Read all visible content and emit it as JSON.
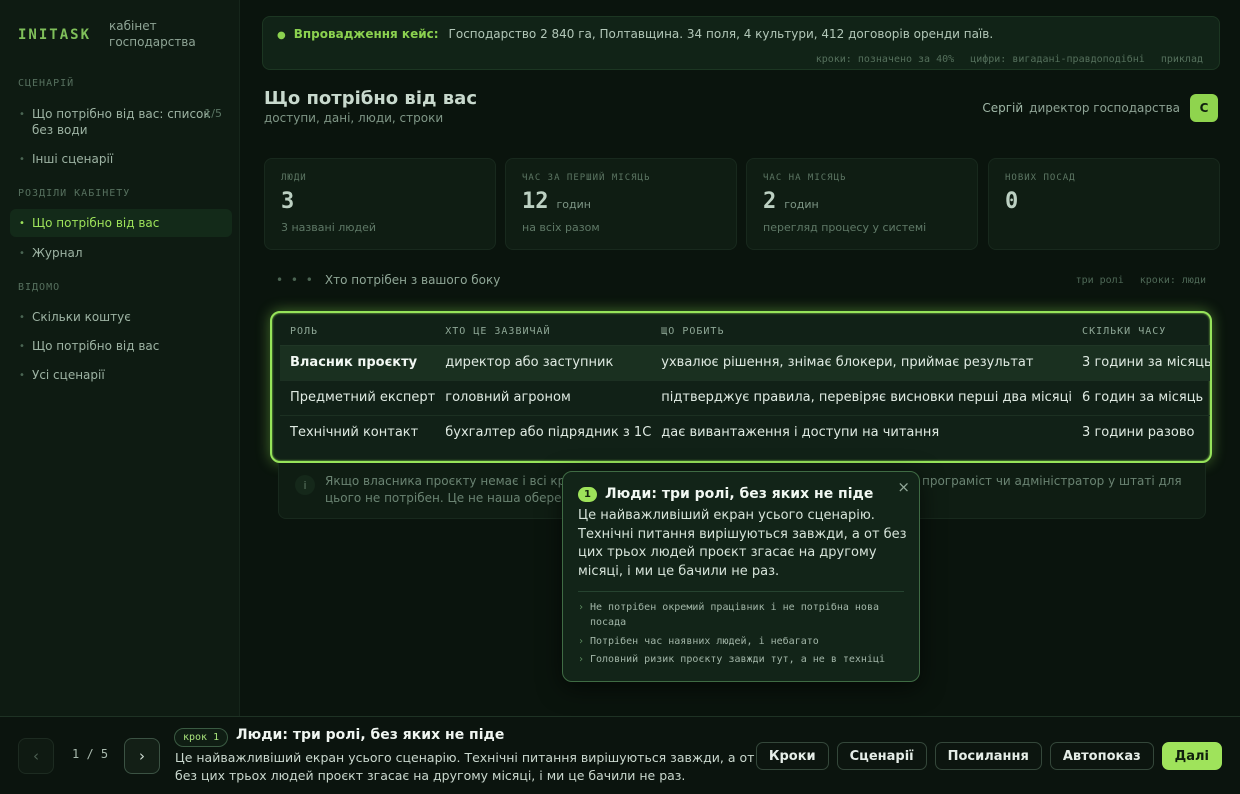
{
  "brand": {
    "logo": "INITASK",
    "subtitle": "кабінет господарства"
  },
  "sidebar": {
    "sections": [
      {
        "title": "СЦЕНАРІЙ",
        "items": [
          {
            "label": "Що потрібно від вас: список без води",
            "count": "1/5"
          },
          {
            "label": "Інші сценарії"
          }
        ]
      },
      {
        "title": "РОЗДІЛИ КАБІНЕТУ",
        "items": [
          {
            "label": "Що потрібно від вас",
            "active": true
          },
          {
            "label": "Журнал"
          }
        ]
      },
      {
        "title": "ВІДОМО",
        "items": [
          {
            "label": "Скільки коштує"
          },
          {
            "label": "Що потрібно від вас"
          },
          {
            "label": "Усі сценарії"
          }
        ]
      }
    ]
  },
  "banner": {
    "label": "Впровадження кейс:",
    "text": "Господарство 2 840 га, Полтавщина. 34 поля, 4 культури, 412 договорів оренди паїв.",
    "meta": [
      "кроки: позначено за 40%",
      "цифри: вигадані-правдоподібні",
      "приклад"
    ]
  },
  "header": {
    "title": "Що потрібно від вас",
    "subtitle": "доступи, дані, люди, строки",
    "user_name": "Сергій",
    "user_role": "директор господарства",
    "avatar": "С"
  },
  "stats": [
    {
      "label": "ЛЮДИ",
      "value": "3",
      "unit": "",
      "foot": "3 названі людей"
    },
    {
      "label": "ЧАС ЗА ПЕРШИЙ МІСЯЦЬ",
      "value": "12",
      "unit": "годин",
      "foot": "на всіх разом"
    },
    {
      "label": "ЧАС НА МІСЯЦЬ",
      "value": "2",
      "unit": "годин",
      "foot": "перегляд процесу у системі"
    },
    {
      "label": "НОВИХ ПОСАД",
      "value": "0",
      "unit": "",
      "foot": ""
    }
  ],
  "section": {
    "dots": "• • •",
    "title": "Хто потрібен з вашого боку",
    "right": [
      "три ролі",
      "кроки: люди"
    ]
  },
  "table": {
    "headers": [
      "РОЛЬ",
      "ХТО ЦЕ ЗАЗВИЧАЙ",
      "ЩО РОБИТЬ",
      "СКІЛЬКИ ЧАСУ"
    ],
    "rows": [
      {
        "role": "Власник проєкту",
        "who": "директор або заступник",
        "what": "ухвалює рішення, знімає блокери, приймає результат",
        "time": "3 години за місяць"
      },
      {
        "role": "Предметний експерт",
        "who": "головний агроном",
        "what": "підтверджує правила, перевіряє висновки перші два місяці",
        "time": "6 годин за місяць"
      },
      {
        "role": "Технічний контакт",
        "who": "бухгалтер або підрядник з 1С",
        "what": "дає вивантаження і доступи на читання",
        "time": "3 години разово"
      }
    ]
  },
  "note": {
    "icon": "i",
    "text": "Якщо власника проєкту немає і всі кроки чекають на рішення, проєкт стопориться. Окремий програміст чи адміністратор у штаті для цього не потрібен. Це не наша обережність, це найчастіша причина провалу."
  },
  "popover": {
    "step": "1",
    "title": "Люди: три ролі, без яких не піде",
    "close": "×",
    "body": "Це найважливіший екран усього сценарію. Технічні питання вирішуються завжди, а от без цих трьох людей проєкт згасає на другому місяці, і ми це бачили не раз.",
    "bullets": [
      "Не потрібен окремий працівник і не потрібна нова посада",
      "Потрібен час наявних людей, і небагато",
      "Головний ризик проєкту завжди тут, а не в техніці"
    ]
  },
  "bottombar": {
    "prev": "‹",
    "next": "›",
    "counter": "1 / 5",
    "step_badge": "крок 1",
    "title": "Люди: три ролі, без яких не піде",
    "text": "Це найважливіший екран усього сценарію. Технічні питання вирішуються завжди, а от без цих трьох людей проєкт згасає на другому місяці, і ми це бачили не раз.",
    "buttons": [
      "Кроки",
      "Сценарії",
      "Посилання",
      "Автопоказ"
    ],
    "primary": "Далі"
  },
  "colors": {
    "accent": "#9fe35b",
    "background": "#0a140d",
    "highlight_border": "#96e35a"
  }
}
